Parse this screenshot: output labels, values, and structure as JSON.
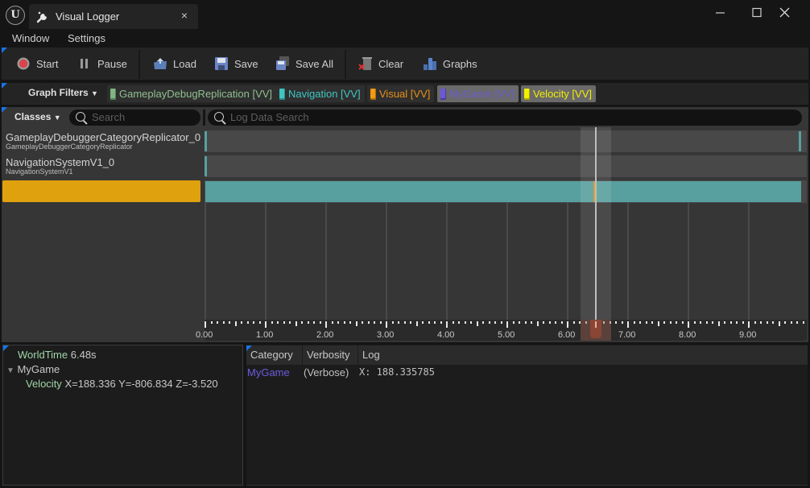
{
  "window": {
    "tab_title": "Visual Logger",
    "tab_close": "×",
    "logo_letter": "U"
  },
  "menu": {
    "items": [
      "Window",
      "Settings"
    ]
  },
  "toolbar": {
    "start": "Start",
    "pause": "Pause",
    "load": "Load",
    "save": "Save",
    "save_all": "Save All",
    "clear": "Clear",
    "graphs": "Graphs"
  },
  "graph_filters": {
    "label": "Graph Filters",
    "items": [
      {
        "label": "GameplayDebugReplication [VV]",
        "color": "#7fb582",
        "text_color": "#8fbf8f",
        "enabled": false
      },
      {
        "label": "Navigation [VV]",
        "color": "#3fc4c0",
        "text_color": "#3fc7c4",
        "enabled": false
      },
      {
        "label": "Visual [VV]",
        "color": "#f39a13",
        "text_color": "#e89017",
        "enabled": false
      },
      {
        "label": "MyGame [VV]",
        "color": "#6c58d6",
        "text_color": "#6a5cd0",
        "enabled": true
      },
      {
        "label": "Velocity [VV]",
        "color": "#f5f000",
        "text_color": "#f2ee00",
        "enabled": true
      }
    ]
  },
  "search": {
    "classes_label": "Classes",
    "classes_placeholder": "Search",
    "log_placeholder": "Log Data Search"
  },
  "classes": [
    {
      "name": "GameplayDebuggerCategoryReplicator_0",
      "subtitle": "GameplayDebuggerCategoryReplicator",
      "selected": false
    },
    {
      "name": "NavigationSystemV1_0",
      "subtitle": "NavigationSystemV1",
      "selected": false
    },
    {
      "name": "",
      "subtitle": "",
      "selected": true
    }
  ],
  "timeline": {
    "range": [
      0.0,
      9.95
    ],
    "cursor_time": 6.48,
    "tick_labels": [
      "0.00",
      "1.00",
      "2.00",
      "3.00",
      "4.00",
      "5.00",
      "6.00",
      "7.00",
      "8.00",
      "9.00"
    ],
    "colors": {
      "track_bar": "#57a09f",
      "event_marker": "#e48f14",
      "cursor_handle": "#8a4535",
      "selected_class": "#e0a10e"
    }
  },
  "details": {
    "world_time_label": "WorldTime",
    "world_time_value": "6.48s",
    "group": "MyGame",
    "entry_label": "Velocity",
    "entry_value": "X=188.336 Y=-806.834 Z=-3.520"
  },
  "log": {
    "columns": [
      "Category",
      "Verbosity",
      "Log"
    ],
    "rows": [
      {
        "category": "MyGame",
        "verbosity": "(Verbose)",
        "log": "X: 188.335785"
      }
    ]
  }
}
